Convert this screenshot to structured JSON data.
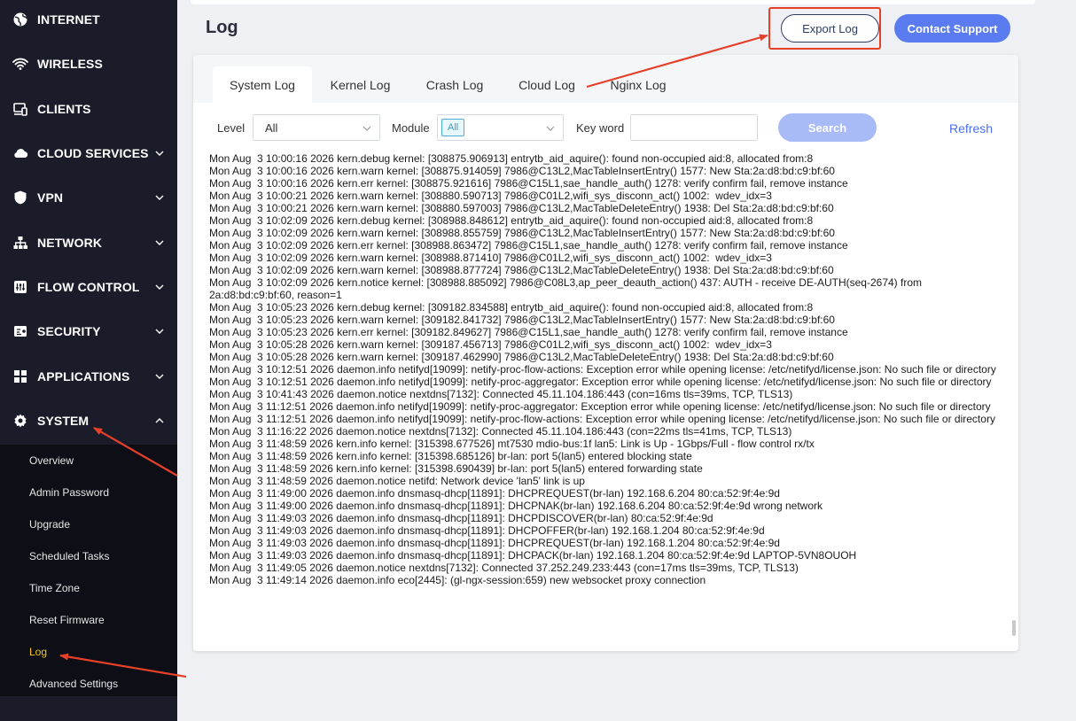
{
  "sidebar": {
    "items": [
      {
        "label": "INTERNET",
        "icon": "globe-icon",
        "chevron": ""
      },
      {
        "label": "WIRELESS",
        "icon": "wifi-icon",
        "chevron": ""
      },
      {
        "label": "CLIENTS",
        "icon": "devices-icon",
        "chevron": ""
      },
      {
        "label": "CLOUD SERVICES",
        "icon": "cloud-icon",
        "chevron": "down"
      },
      {
        "label": "VPN",
        "icon": "shield-icon",
        "chevron": "down"
      },
      {
        "label": "NETWORK",
        "icon": "network-icon",
        "chevron": "down"
      },
      {
        "label": "FLOW CONTROL",
        "icon": "flow-control-icon",
        "chevron": "down"
      },
      {
        "label": "SECURITY",
        "icon": "security-icon",
        "chevron": "down"
      },
      {
        "label": "APPLICATIONS",
        "icon": "applications-icon",
        "chevron": "down"
      },
      {
        "label": "SYSTEM",
        "icon": "gear-icon",
        "chevron": "up"
      }
    ],
    "submenu": [
      {
        "label": "Overview",
        "active": false
      },
      {
        "label": "Admin Password",
        "active": false
      },
      {
        "label": "Upgrade",
        "active": false
      },
      {
        "label": "Scheduled Tasks",
        "active": false
      },
      {
        "label": "Time Zone",
        "active": false
      },
      {
        "label": "Reset Firmware",
        "active": false
      },
      {
        "label": "Log",
        "active": true
      },
      {
        "label": "Advanced Settings",
        "active": false
      }
    ]
  },
  "header": {
    "title": "Log",
    "export_label": "Export Log",
    "contact_label": "Contact Support"
  },
  "tabs": [
    {
      "label": "System Log",
      "active": true
    },
    {
      "label": "Kernel Log",
      "active": false
    },
    {
      "label": "Crash Log",
      "active": false
    },
    {
      "label": "Cloud Log",
      "active": false
    },
    {
      "label": "Nginx Log",
      "active": false
    }
  ],
  "filters": {
    "level_label": "Level",
    "level_value": "All",
    "module_label": "Module",
    "module_value": "All",
    "keyword_label": "Key word",
    "keyword_value": "",
    "search_label": "Search",
    "refresh_label": "Refresh"
  },
  "log_lines": [
    "Mon Aug  3 10:00:16 2026 kern.debug kernel: [308875.906913] entrytb_aid_aquire(): found non-occupied aid:8, allocated from:8",
    "Mon Aug  3 10:00:16 2026 kern.warn kernel: [308875.914059] 7986@C13L2,MacTableInsertEntry() 1577: New Sta:2a:d8:bd:c9:bf:60",
    "Mon Aug  3 10:00:16 2026 kern.err kernel: [308875.921616] 7986@C15L1,sae_handle_auth() 1278: verify confirm fail, remove instance",
    "Mon Aug  3 10:00:21 2026 kern.warn kernel: [308880.590713] 7986@C01L2,wifi_sys_disconn_act() 1002:  wdev_idx=3",
    "Mon Aug  3 10:00:21 2026 kern.warn kernel: [308880.597003] 7986@C13L2,MacTableDeleteEntry() 1938: Del Sta:2a:d8:bd:c9:bf:60",
    "Mon Aug  3 10:02:09 2026 kern.debug kernel: [308988.848612] entrytb_aid_aquire(): found non-occupied aid:8, allocated from:8",
    "Mon Aug  3 10:02:09 2026 kern.warn kernel: [308988.855759] 7986@C13L2,MacTableInsertEntry() 1577: New Sta:2a:d8:bd:c9:bf:60",
    "Mon Aug  3 10:02:09 2026 kern.err kernel: [308988.863472] 7986@C15L1,sae_handle_auth() 1278: verify confirm fail, remove instance",
    "Mon Aug  3 10:02:09 2026 kern.warn kernel: [308988.871410] 7986@C01L2,wifi_sys_disconn_act() 1002:  wdev_idx=3",
    "Mon Aug  3 10:02:09 2026 kern.warn kernel: [308988.877724] 7986@C13L2,MacTableDeleteEntry() 1938: Del Sta:2a:d8:bd:c9:bf:60",
    "Mon Aug  3 10:02:09 2026 kern.notice kernel: [308988.885092] 7986@C08L3,ap_peer_deauth_action() 437: AUTH - receive DE-AUTH(seq-2674) from 2a:d8:bd:c9:bf:60, reason=1",
    "Mon Aug  3 10:05:23 2026 kern.debug kernel: [309182.834588] entrytb_aid_aquire(): found non-occupied aid:8, allocated from:8",
    "Mon Aug  3 10:05:23 2026 kern.warn kernel: [309182.841732] 7986@C13L2,MacTableInsertEntry() 1577: New Sta:2a:d8:bd:c9:bf:60",
    "Mon Aug  3 10:05:23 2026 kern.err kernel: [309182.849627] 7986@C15L1,sae_handle_auth() 1278: verify confirm fail, remove instance",
    "Mon Aug  3 10:05:28 2026 kern.warn kernel: [309187.456713] 7986@C01L2,wifi_sys_disconn_act() 1002:  wdev_idx=3",
    "Mon Aug  3 10:05:28 2026 kern.warn kernel: [309187.462990] 7986@C13L2,MacTableDeleteEntry() 1938: Del Sta:2a:d8:bd:c9:bf:60",
    "Mon Aug  3 10:12:51 2026 daemon.info netifyd[19099]: netify-proc-flow-actions: Exception error while opening license: /etc/netifyd/license.json: No such file or directory",
    "Mon Aug  3 10:12:51 2026 daemon.info netifyd[19099]: netify-proc-aggregator: Exception error while opening license: /etc/netifyd/license.json: No such file or directory",
    "Mon Aug  3 10:41:43 2026 daemon.notice nextdns[7132]: Connected 45.11.104.186:443 (con=16ms tls=39ms, TCP, TLS13)",
    "Mon Aug  3 11:12:51 2026 daemon.info netifyd[19099]: netify-proc-aggregator: Exception error while opening license: /etc/netifyd/license.json: No such file or directory",
    "Mon Aug  3 11:12:51 2026 daemon.info netifyd[19099]: netify-proc-flow-actions: Exception error while opening license: /etc/netifyd/license.json: No such file or directory",
    "Mon Aug  3 11:16:22 2026 daemon.notice nextdns[7132]: Connected 45.11.104.186:443 (con=22ms tls=41ms, TCP, TLS13)",
    "Mon Aug  3 11:48:59 2026 kern.info kernel: [315398.677526] mt7530 mdio-bus:1f lan5: Link is Up - 1Gbps/Full - flow control rx/tx",
    "Mon Aug  3 11:48:59 2026 kern.info kernel: [315398.685126] br-lan: port 5(lan5) entered blocking state",
    "Mon Aug  3 11:48:59 2026 kern.info kernel: [315398.690439] br-lan: port 5(lan5) entered forwarding state",
    "Mon Aug  3 11:48:59 2026 daemon.notice netifd: Network device 'lan5' link is up",
    "Mon Aug  3 11:49:00 2026 daemon.info dnsmasq-dhcp[11891]: DHCPREQUEST(br-lan) 192.168.6.204 80:ca:52:9f:4e:9d",
    "Mon Aug  3 11:49:00 2026 daemon.info dnsmasq-dhcp[11891]: DHCPNAK(br-lan) 192.168.6.204 80:ca:52:9f:4e:9d wrong network",
    "Mon Aug  3 11:49:03 2026 daemon.info dnsmasq-dhcp[11891]: DHCPDISCOVER(br-lan) 80:ca:52:9f:4e:9d",
    "Mon Aug  3 11:49:03 2026 daemon.info dnsmasq-dhcp[11891]: DHCPOFFER(br-lan) 192.168.1.204 80:ca:52:9f:4e:9d",
    "Mon Aug  3 11:49:03 2026 daemon.info dnsmasq-dhcp[11891]: DHCPREQUEST(br-lan) 192.168.1.204 80:ca:52:9f:4e:9d",
    "Mon Aug  3 11:49:03 2026 daemon.info dnsmasq-dhcp[11891]: DHCPACK(br-lan) 192.168.1.204 80:ca:52:9f:4e:9d LAPTOP-5VN8OUOH",
    "Mon Aug  3 11:49:05 2026 daemon.notice nextdns[7132]: Connected 37.252.249.233:443 (con=17ms tls=39ms, TCP, TLS13)",
    "Mon Aug  3 11:49:14 2026 daemon.info eco[2445]: (gl-ngx-session:659) new websocket proxy connection"
  ],
  "colors": {
    "sidebar_bg": "#1a1c29",
    "submenu_bg": "#0d0e16",
    "active_submenu": "#f5c518",
    "accent_blue": "#5a7cf0",
    "annotation_red": "#e5402a"
  }
}
